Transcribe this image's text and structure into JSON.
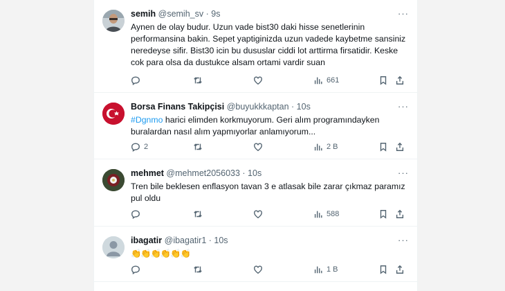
{
  "tweets": [
    {
      "name": "semih",
      "handle": "@semih_sv",
      "time": "· 9s",
      "text": "Aynen de olay budur. Uzun vade bist30 daki hisse senetlerinin performansina bakin. Sepet yaptiginizda uzun vadede kaybetme sansiniz neredeyse sifir. Bist30 icin bu dususlar ciddi lot arttirma firsatidir. Keske cok para olsa da dustukce alsam ortami vardir suan",
      "replies": "",
      "views": "661",
      "avatar": "person-photo"
    },
    {
      "name": "Borsa Finans Takipçisi",
      "handle": "@buyukkkaptan",
      "time": "· 10s",
      "hashtag": "#Dgnmo",
      "text": " harici elimden korkmuyorum. Geri alım programındayken buralardan nasıl alım yapmıyorlar anlamıyorum...",
      "replies": "2",
      "views": "2 B",
      "avatar": "turkish-flag"
    },
    {
      "name": "mehmet",
      "handle": "@mehmet2056033",
      "time": "· 10s",
      "text": "Tren bile beklesen enflasyon tavan 3 e atlasak bile zarar çıkmaz paramız pul oldu",
      "replies": "",
      "views": "588",
      "avatar": "flower-photo"
    },
    {
      "name": "ibagatir",
      "handle": "@ibagatir1",
      "time": "· 10s",
      "text": "👏👏👏👏👏👏",
      "replies": "",
      "views": "1 B",
      "avatar": "default-avatar"
    }
  ],
  "more_label": "···",
  "colors": {
    "hashtag": "#1d9bf0",
    "meta": "#536471",
    "text": "#0f1419"
  }
}
